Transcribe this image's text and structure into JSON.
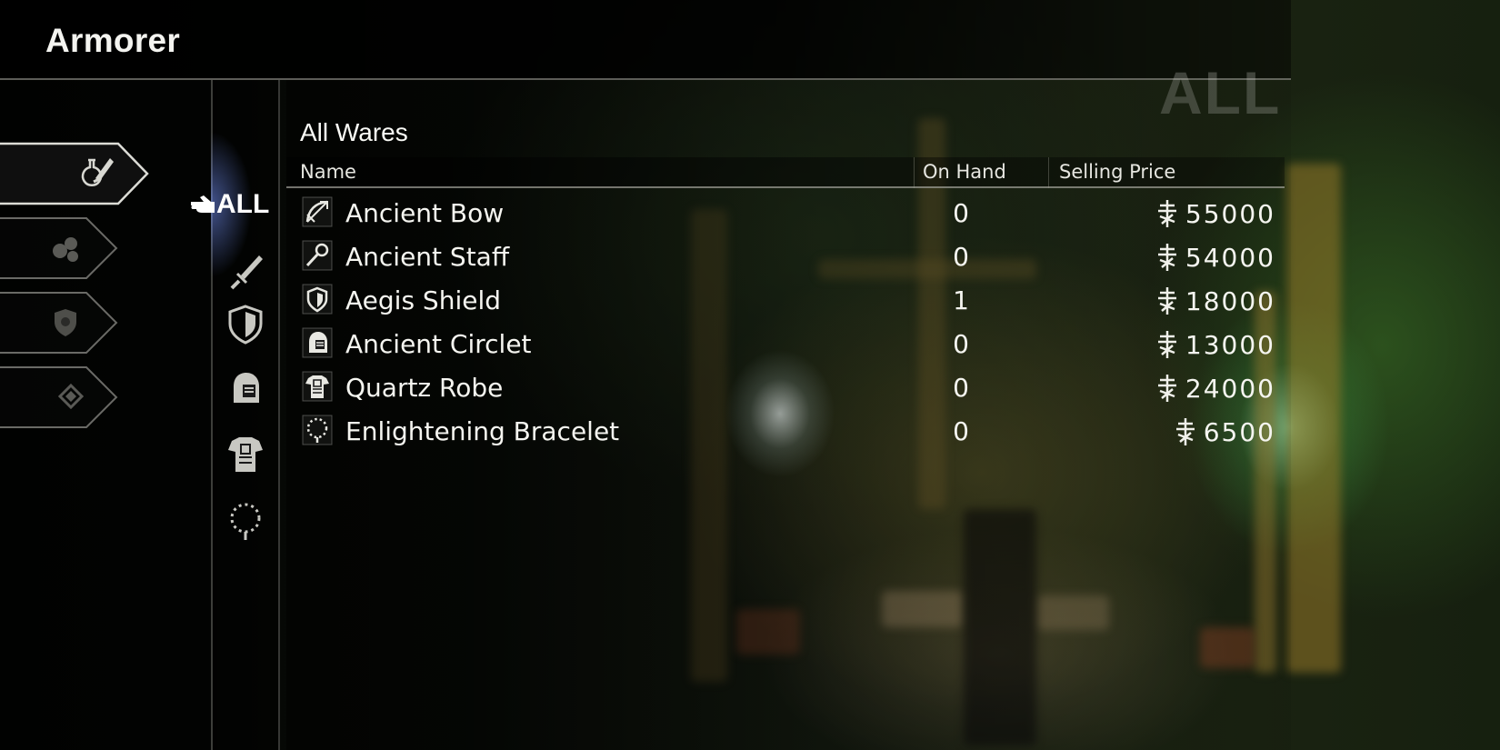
{
  "header": {
    "title": "Armorer",
    "filter_watermark": "ALL"
  },
  "categories": [
    {
      "icon": "potion-sword-icon",
      "selected": true
    },
    {
      "icon": "ingredients-icon",
      "selected": false
    },
    {
      "icon": "shield-gear-icon",
      "selected": false
    },
    {
      "icon": "diamond-icon",
      "selected": false
    }
  ],
  "filters": {
    "active_label": "ALL",
    "items": [
      {
        "icon": "sword-icon"
      },
      {
        "icon": "shield-icon"
      },
      {
        "icon": "helmet-icon"
      },
      {
        "icon": "robe-icon"
      },
      {
        "icon": "bracelet-icon"
      }
    ]
  },
  "list": {
    "title": "All Wares",
    "columns": {
      "name": "Name",
      "on_hand": "On Hand",
      "price": "Selling Price"
    },
    "items": [
      {
        "icon": "bow-icon",
        "name": "Ancient Bow",
        "on_hand": "0",
        "price": "55000"
      },
      {
        "icon": "staff-icon",
        "name": "Ancient Staff",
        "on_hand": "0",
        "price": "54000"
      },
      {
        "icon": "shield-icon",
        "name": "Aegis Shield",
        "on_hand": "1",
        "price": "18000"
      },
      {
        "icon": "helmet-icon",
        "name": "Ancient Circlet",
        "on_hand": "0",
        "price": "13000"
      },
      {
        "icon": "robe-icon",
        "name": "Quartz Robe",
        "on_hand": "0",
        "price": "24000"
      },
      {
        "icon": "bracelet-icon",
        "name": "Enlightening Bracelet",
        "on_hand": "0",
        "price": "6500"
      }
    ]
  },
  "colors": {
    "highlight_glow": "#7890ff",
    "text": "#f5f5f0",
    "divider": "#b4b4a8"
  }
}
